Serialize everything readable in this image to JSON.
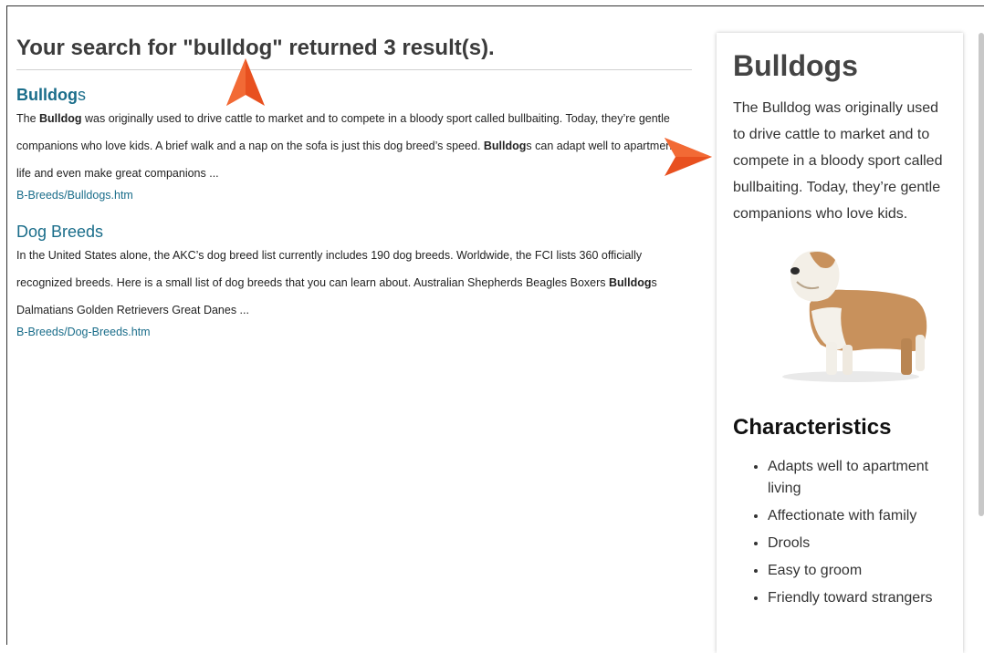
{
  "search": {
    "heading": "Your search for \"bulldog\" returned 3 result(s)."
  },
  "results": [
    {
      "title_bold": "Bulldog",
      "title_rest": "s",
      "snippet_parts": [
        {
          "t": "The ",
          "b": false
        },
        {
          "t": "Bulldog",
          "b": true
        },
        {
          "t": " was originally used to drive cattle to market and to compete in a bloody sport called bullbaiting. Today, they’re gentle companions who love kids. A brief walk and a nap on the sofa is just this dog breed’s speed. ",
          "b": false
        },
        {
          "t": "Bulldog",
          "b": true
        },
        {
          "t": "s can adapt well to apartment life and even make great companions ...",
          "b": false
        }
      ],
      "url": "B-Breeds/Bulldogs.htm"
    },
    {
      "title_bold": "",
      "title_rest": "Dog Breeds",
      "snippet_parts": [
        {
          "t": "In the United States alone, the AKC’s dog breed list currently includes 190 dog breeds. Worldwide, the FCI lists 360 officially recognized breeds. Here is a small list of dog breeds that you can learn about. Australian Shepherds Beagles Boxers ",
          "b": false
        },
        {
          "t": "Bulldog",
          "b": true
        },
        {
          "t": "s Dalmatians Golden Retrievers Great Danes ...",
          "b": false
        }
      ],
      "url": "B-Breeds/Dog-Breeds.htm"
    }
  ],
  "sidebar": {
    "title": "Bulldogs",
    "description": "The Bulldog was originally used to drive cattle to market and to compete in a bloody sport called bullbaiting. Today, they’re gentle companions who love kids.",
    "characteristics_heading": "Characteristics",
    "traits": [
      "Adapts well to apartment living",
      "Affectionate with family",
      "Drools",
      "Easy to groom",
      "Friendly toward strangers"
    ]
  },
  "colors": {
    "link": "#1a6d8a",
    "pointer": "#e8501f"
  },
  "icons": {
    "pointer_up": "arrow-pointer-up-icon",
    "pointer_right": "arrow-pointer-right-icon"
  }
}
